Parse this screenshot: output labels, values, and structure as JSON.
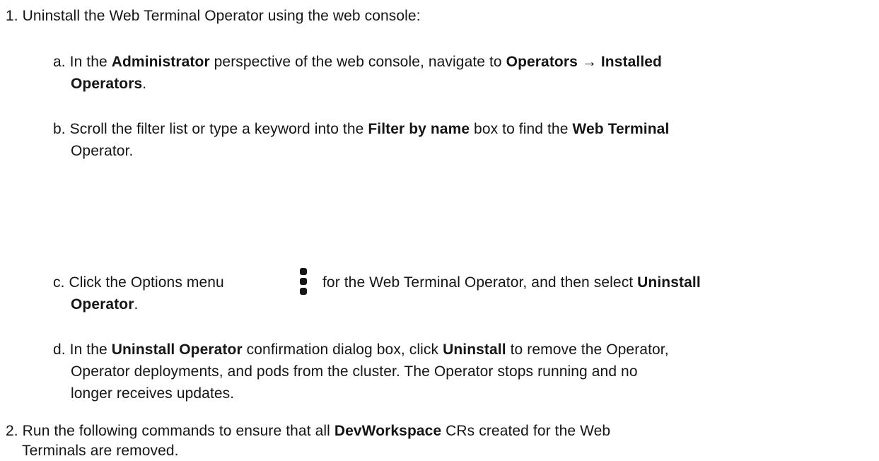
{
  "steps": [
    {
      "number": "1.",
      "text": "Uninstall the Web Terminal Operator using the web console:",
      "substeps": [
        {
          "letter": "a.",
          "l1": "In the ",
          "l1_b1": "Administrator",
          "l1_mid": " perspective of the web console, navigate to ",
          "l1_b2": "Operators → Installed",
          "l2_b": "Operators",
          "l2_end": "."
        },
        {
          "letter": "b.",
          "l1": "Scroll the filter list or type a keyword into the ",
          "l1_b1": "Filter by name",
          "l1_mid": " box to find the ",
          "l1_b2": "Web Terminal",
          "l2": "Operator."
        },
        {
          "letter": "c.",
          "l1": "Click the Options menu",
          "icon": "kebab-vertical-icon",
          "l1_mid": "for the Web Terminal Operator, and then select ",
          "l1_b": "Uninstall",
          "l2_b": "Operator",
          "l2_end": "."
        },
        {
          "letter": "d.",
          "l1": "In the ",
          "l1_b1": "Uninstall Operator",
          "l1_mid": " confirmation dialog box, click ",
          "l1_b2": "Uninstall",
          "l1_end": " to remove the Operator,",
          "l2": "Operator deployments, and pods from the cluster. The Operator stops running and no",
          "l3": "longer receives updates."
        }
      ]
    },
    {
      "number": "2.",
      "l1": "Run the following commands to ensure that all ",
      "l1_b": "DevWorkspace",
      "l1_end": " CRs created for the Web",
      "l2": "Terminals are removed."
    }
  ]
}
